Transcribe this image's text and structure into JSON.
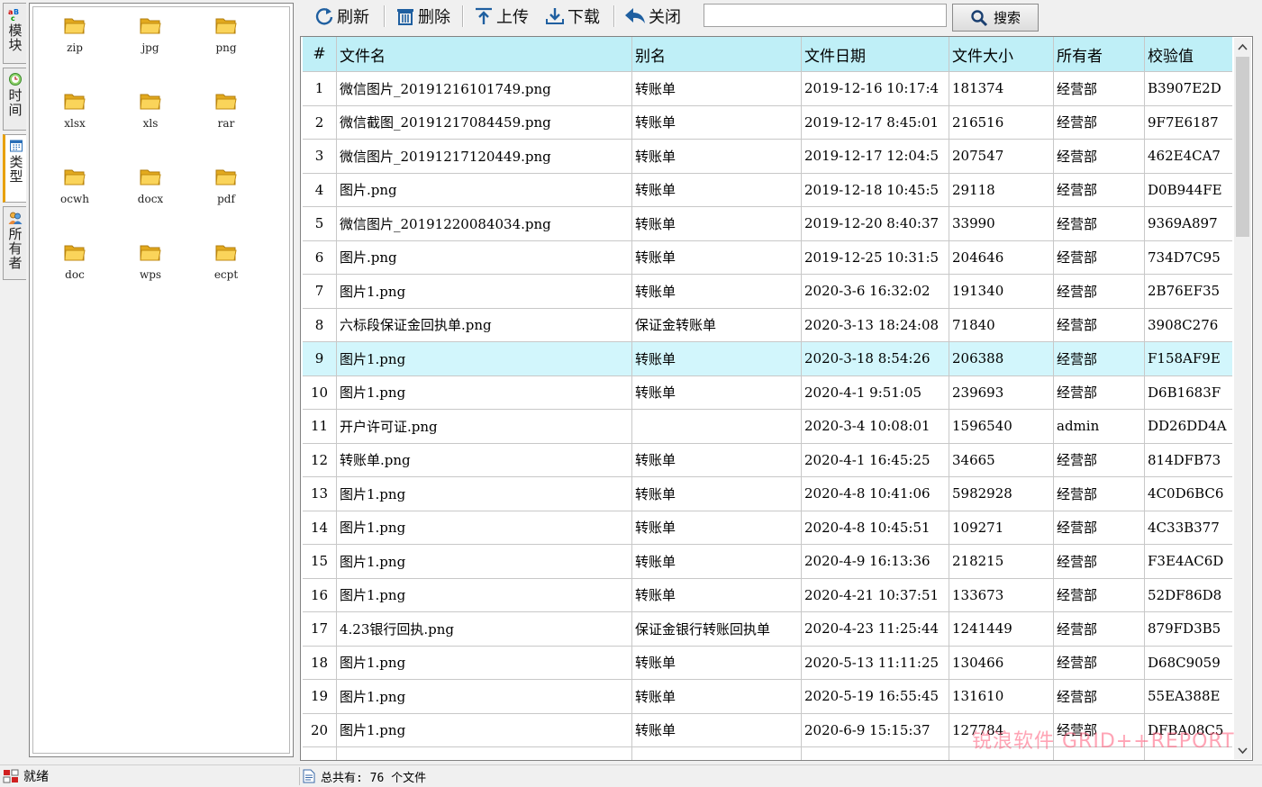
{
  "sidebar": {
    "tabs": [
      {
        "label": "模块",
        "icon": "abc-icon",
        "active": false
      },
      {
        "label": "时间",
        "icon": "clock-icon",
        "active": false
      },
      {
        "label": "类型",
        "icon": "calendar-grid-icon",
        "active": true
      },
      {
        "label": "所有者",
        "icon": "users-icon",
        "active": false
      }
    ]
  },
  "folders": [
    "zip",
    "jpg",
    "png",
    "xlsx",
    "xls",
    "rar",
    "ocwh",
    "docx",
    "pdf",
    "doc",
    "wps",
    "ecpt"
  ],
  "toolbar": {
    "refresh_label": "刷新",
    "delete_label": "删除",
    "upload_label": "上传",
    "download_label": "下载",
    "close_label": "关闭",
    "search_value": "",
    "search_label": "搜索"
  },
  "table": {
    "columns": [
      "#",
      "文件名",
      "别名",
      "文件日期",
      "文件大小",
      "所有者",
      "校验值"
    ],
    "rows": [
      [
        "1",
        "微信图片_20191216101749.png",
        "转账单",
        "2019-12-16 10:17:4",
        "181374",
        "经营部",
        "B3907E2D"
      ],
      [
        "2",
        "微信截图_20191217084459.png",
        "转账单",
        "2019-12-17 8:45:01",
        "216516",
        "经营部",
        "9F7E6187"
      ],
      [
        "3",
        "微信图片_20191217120449.png",
        "转账单",
        "2019-12-17 12:04:5",
        "207547",
        "经营部",
        "462E4CA7"
      ],
      [
        "4",
        "图片.png",
        "转账单",
        "2019-12-18 10:45:5",
        "29118",
        "经营部",
        "D0B944FE"
      ],
      [
        "5",
        "微信图片_20191220084034.png",
        "转账单",
        "2019-12-20 8:40:37",
        "33990",
        "经营部",
        "9369A897"
      ],
      [
        "6",
        "图片.png",
        "转账单",
        "2019-12-25 10:31:5",
        "204646",
        "经营部",
        "734D7C95"
      ],
      [
        "7",
        "图片1.png",
        "转账单",
        "2020-3-6 16:32:02",
        "191340",
        "经营部",
        "2B76EF35"
      ],
      [
        "8",
        "六标段保证金回执单.png",
        "保证金转账单",
        "2020-3-13 18:24:08",
        "71840",
        "经营部",
        "3908C276"
      ],
      [
        "9",
        "图片1.png",
        "转账单",
        "2020-3-18 8:54:26",
        "206388",
        "经营部",
        "F158AF9E"
      ],
      [
        "10",
        "图片1.png",
        "转账单",
        "2020-4-1 9:51:05",
        "239693",
        "经营部",
        "D6B1683F"
      ],
      [
        "11",
        "开户许可证.png",
        "",
        "2020-3-4 10:08:01",
        "1596540",
        "admin",
        "DD26DD4A"
      ],
      [
        "12",
        "转账单.png",
        "转账单",
        "2020-4-1 16:45:25",
        "34665",
        "经营部",
        "814DFB73"
      ],
      [
        "13",
        "图片1.png",
        "转账单",
        "2020-4-8 10:41:06",
        "5982928",
        "经营部",
        "4C0D6BC6"
      ],
      [
        "14",
        "图片1.png",
        "转账单",
        "2020-4-8 10:45:51",
        "109271",
        "经营部",
        "4C33B377"
      ],
      [
        "15",
        "图片1.png",
        "转账单",
        "2020-4-9 16:13:36",
        "218215",
        "经营部",
        "F3E4AC6D"
      ],
      [
        "16",
        "图片1.png",
        "转账单",
        "2020-4-21 10:37:51",
        "133673",
        "经营部",
        "52DF86D8"
      ],
      [
        "17",
        "4.23银行回执.png",
        "保证金银行转账回执单",
        "2020-4-23 11:25:44",
        "1241449",
        "经营部",
        "879FD3B5"
      ],
      [
        "18",
        "图片1.png",
        "转账单",
        "2020-5-13 11:11:25",
        "130466",
        "经营部",
        "D68C9059"
      ],
      [
        "19",
        "图片1.png",
        "转账单",
        "2020-5-19 16:55:45",
        "131610",
        "经营部",
        "55EA388E"
      ],
      [
        "20",
        "图片1.png",
        "转账单",
        "2020-6-9 15:15:37",
        "127784",
        "经营部",
        "DFBA08C5"
      ]
    ],
    "selected_row": 9
  },
  "watermark": "锐浪软件 GRID++REPORT",
  "status": {
    "left": "就绪",
    "right": "总共有: 76 个文件"
  },
  "colors": {
    "header_bg": "#bfeff7",
    "selected_bg": "#d2f6fc",
    "folder_yellow": "#f7c948",
    "toolbar_icon": "#1f5fa0"
  }
}
